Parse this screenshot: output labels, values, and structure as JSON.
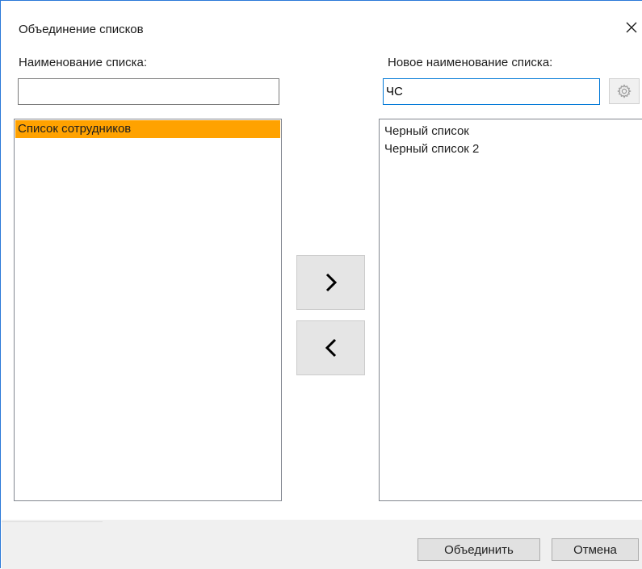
{
  "dialog": {
    "title": "Объединение списков",
    "close_glyph": "✕"
  },
  "left": {
    "label": "Наименование списка:",
    "input_value": "",
    "items": [
      {
        "label": "Список сотрудников",
        "selected": true
      }
    ]
  },
  "right": {
    "label": "Новое наименование списка:",
    "input_value": "ЧС",
    "settings_icon": "gear-icon",
    "items": [
      {
        "label": "Черный список",
        "selected": false
      },
      {
        "label": "Черный список 2",
        "selected": false
      }
    ]
  },
  "transfer": {
    "move_right_icon": "chevron-right-icon",
    "move_left_icon": "chevron-left-icon"
  },
  "footer": {
    "ok_label": "Объединить",
    "cancel_label": "Отмена"
  },
  "colors": {
    "selection": "#ffa200",
    "focus_border": "#0078d7",
    "footer_bg": "#f0f0f0"
  }
}
